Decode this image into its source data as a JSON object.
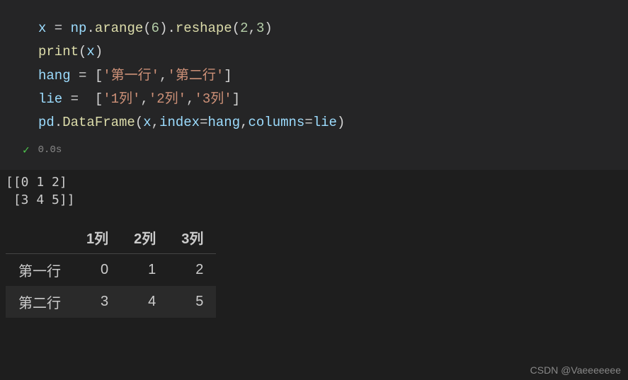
{
  "code": {
    "line1": {
      "var": "x",
      "eq": " = ",
      "mod": "np",
      "dot1": ".",
      "fn1": "arange",
      "p1": "(",
      "n1": "6",
      "p2": ").",
      "fn2": "reshape",
      "p3": "(",
      "n2": "2",
      "c": ",",
      "n3": "3",
      "p4": ")"
    },
    "line2": {
      "fn": "print",
      "p1": "(",
      "var": "x",
      "p2": ")"
    },
    "line3": {
      "var": "hang",
      "eq": " = ",
      "b1": "[",
      "s1": "'第一行'",
      "c1": ",",
      "s2": "'第二行'",
      "b2": "]"
    },
    "line4": {
      "var": "lie",
      "eq": " =  ",
      "b1": "[",
      "s1": "'1列'",
      "c1": ",",
      "s2": "'2列'",
      "c2": ",",
      "s3": "'3列'",
      "b2": "]"
    },
    "line5": {
      "mod": "pd",
      "dot": ".",
      "fn": "DataFrame",
      "p1": "(",
      "var": "x",
      "c1": ",",
      "k1": "index",
      "e1": "=",
      "v1": "hang",
      "c2": ",",
      "k2": "columns",
      "e2": "=",
      "v2": "lie",
      "p2": ")"
    }
  },
  "status": {
    "time": "0.0s"
  },
  "output_text": "[[0 1 2]\n [3 4 5]]",
  "table": {
    "columns": [
      "1列",
      "2列",
      "3列"
    ],
    "index": [
      "第一行",
      "第二行"
    ],
    "rows": [
      [
        "0",
        "1",
        "2"
      ],
      [
        "3",
        "4",
        "5"
      ]
    ]
  },
  "watermark": "CSDN @Vaeeeeeee",
  "chart_data": {
    "type": "table",
    "columns": [
      "1列",
      "2列",
      "3列"
    ],
    "index": [
      "第一行",
      "第二行"
    ],
    "data": [
      [
        0,
        1,
        2
      ],
      [
        3,
        4,
        5
      ]
    ]
  }
}
